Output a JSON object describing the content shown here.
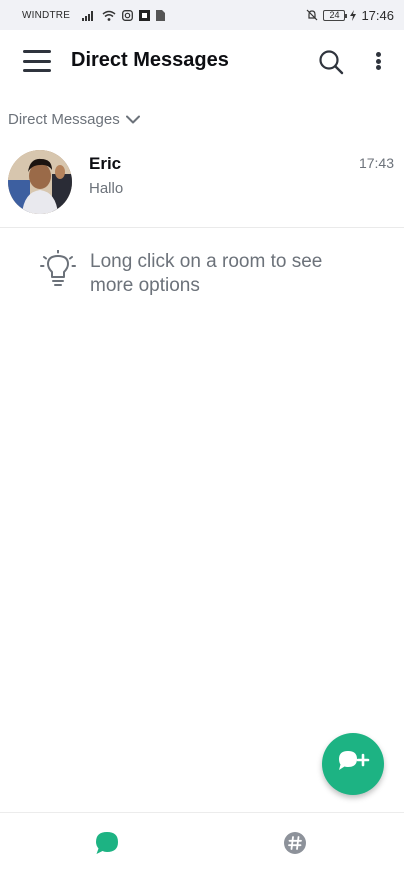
{
  "status_bar": {
    "carrier": "WINDTRE",
    "battery": "24",
    "time": "17:46"
  },
  "header": {
    "title": "Direct Messages",
    "menu_icon": "hamburger-menu-icon",
    "search_icon": "search-icon",
    "more_icon": "kebab-menu-icon"
  },
  "section": {
    "label": "Direct Messages",
    "icon": "chevron-down-icon"
  },
  "rooms": [
    {
      "name": "Eric",
      "last_message": "Hallo",
      "time": "17:43"
    }
  ],
  "tip": {
    "icon": "lightbulb-icon",
    "text": "Long click on a room to see more options"
  },
  "fab": {
    "icon": "new-message-icon"
  },
  "bottom_nav": {
    "tabs": [
      {
        "icon": "chat-bubble-icon",
        "active": true,
        "color": "#1db383"
      },
      {
        "icon": "hashtag-icon",
        "active": false,
        "color": "#8d929a"
      }
    ]
  },
  "colors": {
    "accent": "#1db383",
    "title": "#0d0e12",
    "secondary_text": "#6c727a",
    "status_bar_bg": "#f1f2f6"
  }
}
